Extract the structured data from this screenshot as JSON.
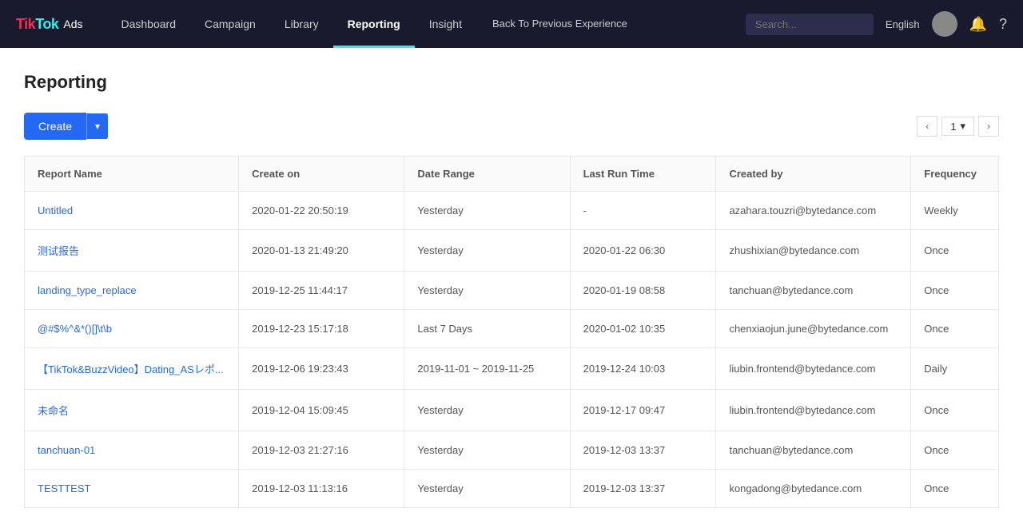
{
  "nav": {
    "logo_tiktok": "TikTok",
    "logo_ads": "Ads",
    "links": [
      {
        "label": "Dashboard",
        "active": false
      },
      {
        "label": "Campaign",
        "active": false
      },
      {
        "label": "Library",
        "active": false
      },
      {
        "label": "Reporting",
        "active": true
      },
      {
        "label": "Insight",
        "active": false
      }
    ],
    "back_label": "Back To Previous Experience",
    "lang": "English",
    "page_num_label": "1"
  },
  "page": {
    "title": "Reporting"
  },
  "toolbar": {
    "create_label": "Create",
    "arrow_label": "▾",
    "page_prev": "‹",
    "page_next": "›",
    "page_num": "1"
  },
  "table": {
    "headers": [
      {
        "label": "Report Name",
        "key": "report_name"
      },
      {
        "label": "Create on",
        "key": "create_on"
      },
      {
        "label": "Date Range",
        "key": "date_range"
      },
      {
        "label": "Last Run Time",
        "key": "last_run_time"
      },
      {
        "label": "Created by",
        "key": "created_by"
      },
      {
        "label": "Frequency",
        "key": "frequency"
      }
    ],
    "rows": [
      {
        "report_name": "Untitled",
        "create_on": "2020-01-22 20:50:19",
        "date_range": "Yesterday",
        "last_run_time": "-",
        "created_by": "azahara.touzri@bytedance.com",
        "frequency": "Weekly"
      },
      {
        "report_name": "测试报告",
        "create_on": "2020-01-13 21:49:20",
        "date_range": "Yesterday",
        "last_run_time": "2020-01-22 06:30",
        "created_by": "zhushixian@bytedance.com",
        "frequency": "Once"
      },
      {
        "report_name": "landing_type_replace",
        "create_on": "2019-12-25 11:44:17",
        "date_range": "Yesterday",
        "last_run_time": "2020-01-19 08:58",
        "created_by": "tanchuan@bytedance.com",
        "frequency": "Once"
      },
      {
        "report_name": "@#$%^&*()[]\\t\\b",
        "create_on": "2019-12-23 15:17:18",
        "date_range": "Last 7 Days",
        "last_run_time": "2020-01-02 10:35",
        "created_by": "chenxiaojun.june@bytedance.com",
        "frequency": "Once"
      },
      {
        "report_name": "【TikTok&BuzzVideo】Dating_ASレポ...",
        "create_on": "2019-12-06 19:23:43",
        "date_range": "2019-11-01 ~ 2019-11-25",
        "last_run_time": "2019-12-24 10:03",
        "created_by": "liubin.frontend@bytedance.com",
        "frequency": "Daily"
      },
      {
        "report_name": "未命名",
        "create_on": "2019-12-04 15:09:45",
        "date_range": "Yesterday",
        "last_run_time": "2019-12-17 09:47",
        "created_by": "liubin.frontend@bytedance.com",
        "frequency": "Once"
      },
      {
        "report_name": "tanchuan-01",
        "create_on": "2019-12-03 21:27:16",
        "date_range": "Yesterday",
        "last_run_time": "2019-12-03 13:37",
        "created_by": "tanchuan@bytedance.com",
        "frequency": "Once"
      },
      {
        "report_name": "TESTTEST",
        "create_on": "2019-12-03 11:13:16",
        "date_range": "Yesterday",
        "last_run_time": "2019-12-03 13:37",
        "created_by": "kongadong@bytedance.com",
        "frequency": "Once"
      }
    ]
  }
}
